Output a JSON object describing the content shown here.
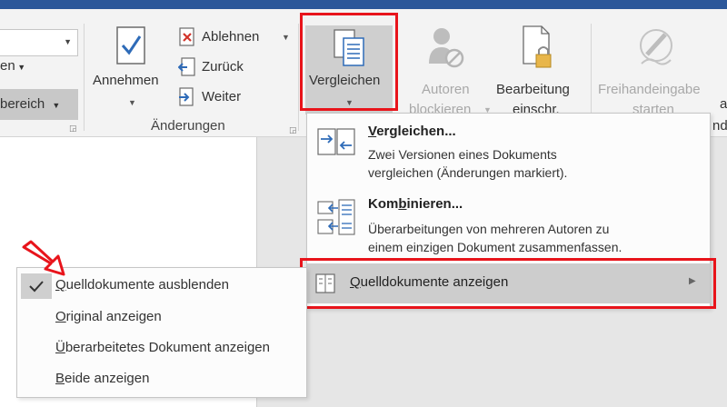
{
  "ribbon": {
    "left": {
      "item1": "en",
      "item2": "bereich"
    },
    "annehmen": "Annehmen",
    "ablehnen": "Ablehnen",
    "zurueck": "Zurück",
    "weiter": "Weiter",
    "group_aenderungen": "Änderungen",
    "vergleichen": "Vergleichen",
    "autoren_line1": "Autoren",
    "autoren_line2": "blockieren",
    "bearbeitung_line1": "Bearbeitung",
    "bearbeitung_line2": "einschr.",
    "freihand_line1": "Freihandeingabe",
    "freihand_line2": "starten",
    "right_a": "a",
    "right_nd": "nd"
  },
  "menu": {
    "vergleichen": {
      "title_u": "V",
      "title_rest": "ergleichen...",
      "desc1": "Zwei Versionen eines Dokuments",
      "desc2": "vergleichen (Änderungen markiert)."
    },
    "kombinieren": {
      "title_pre": "Kom",
      "title_u": "b",
      "title_rest": "inieren...",
      "desc1": "Überarbeitungen von mehreren Autoren zu",
      "desc2": "einem einzigen Dokument zusammenfassen."
    },
    "quelldokumente": {
      "label_u": "Q",
      "label_rest": "uelldokumente anzeigen"
    }
  },
  "submenu": {
    "items": [
      {
        "u": "Q",
        "rest": "uelldokumente ausblenden",
        "checked": true
      },
      {
        "u": "O",
        "rest": "riginal anzeigen",
        "checked": false
      },
      {
        "u": "Ü",
        "rest": "berarbeitetes Dokument anzeigen",
        "checked": false
      },
      {
        "u": "B",
        "rest": "eide anzeigen",
        "checked": false
      }
    ]
  },
  "colors": {
    "highlight_red": "#e8141b",
    "ribbon_bg": "#f3f3f3",
    "title_blue": "#2b579a",
    "icon_blue": "#2e6bb8"
  }
}
